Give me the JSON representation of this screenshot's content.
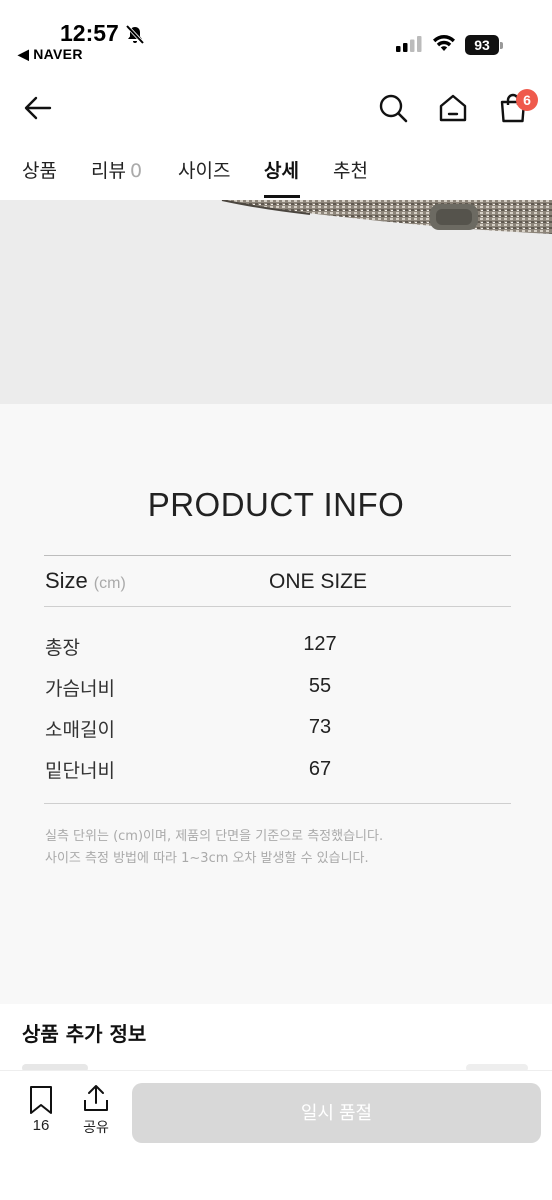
{
  "status_bar": {
    "time": "12:57",
    "back_app": "◀ NAVER",
    "battery": "93"
  },
  "header": {
    "cart_count": "6"
  },
  "tabs": [
    {
      "label": "상품"
    },
    {
      "label": "리뷰",
      "count": "0"
    },
    {
      "label": "사이즈"
    },
    {
      "label": "상세"
    },
    {
      "label": "추천"
    }
  ],
  "product_info": {
    "title": "PRODUCT INFO",
    "size_label": "Size",
    "size_unit": "(cm)",
    "size_column": "ONE SIZE",
    "rows": [
      {
        "label": "총장",
        "value": "127"
      },
      {
        "label": "가슴너비",
        "value": "55"
      },
      {
        "label": "소매길이",
        "value": "73"
      },
      {
        "label": "밑단너비",
        "value": "67"
      }
    ],
    "notes": [
      "실측 단위는 (cm)이며, 제품의 단면을 기준으로 측정했습니다.",
      "사이즈 측정 방법에 따라 1~3cm 오차 발생할 수 있습니다."
    ]
  },
  "extra_info": {
    "title": "상품 추가 정보"
  },
  "bottom_bar": {
    "bookmark_count": "16",
    "share_label": "공유",
    "soldout_label": "일시 품절"
  }
}
